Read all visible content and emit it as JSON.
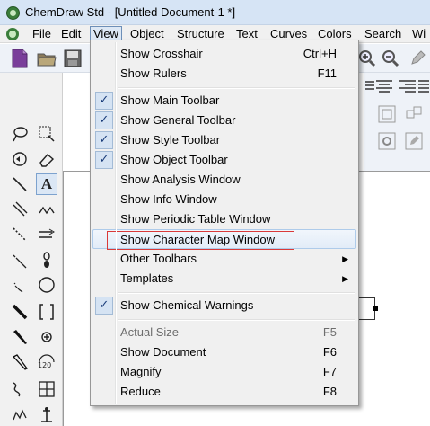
{
  "window": {
    "title": "ChemDraw Std - [Untitled Document-1 *]"
  },
  "menubar": {
    "items": [
      {
        "label": "File"
      },
      {
        "label": "Edit"
      },
      {
        "label": "View"
      },
      {
        "label": "Object"
      },
      {
        "label": "Structure"
      },
      {
        "label": "Text"
      },
      {
        "label": "Curves"
      },
      {
        "label": "Colors"
      },
      {
        "label": "Search"
      },
      {
        "label": "Wi"
      }
    ],
    "active": "View"
  },
  "view_menu": {
    "items": [
      {
        "label": "Show Crosshair",
        "shortcut": "Ctrl+H",
        "checked": false
      },
      {
        "label": "Show Rulers",
        "shortcut": "F11",
        "checked": false
      },
      {
        "label": "Show Main Toolbar",
        "checked": true
      },
      {
        "label": "Show General Toolbar",
        "checked": true
      },
      {
        "label": "Show Style Toolbar",
        "checked": true
      },
      {
        "label": "Show Object Toolbar",
        "checked": true
      },
      {
        "label": "Show Analysis Window",
        "checked": false
      },
      {
        "label": "Show Info Window",
        "checked": false
      },
      {
        "label": "Show Periodic Table Window",
        "checked": false
      },
      {
        "label": "Show Character Map Window",
        "checked": false,
        "highlighted": true
      },
      {
        "label": "Other Toolbars",
        "submenu": true
      },
      {
        "label": "Templates",
        "submenu": true
      },
      {
        "label": "Show Chemical Warnings",
        "checked": true
      },
      {
        "label": "Actual Size",
        "shortcut": "F5",
        "disabled": true
      },
      {
        "label": "Show Document",
        "shortcut": "F6"
      },
      {
        "label": "Magnify",
        "shortcut": "F7"
      },
      {
        "label": "Reduce",
        "shortcut": "F8"
      }
    ],
    "check_glyph": "✓",
    "submenu_glyph": "▶"
  },
  "palette_text": {
    "text_tool": "A",
    "number_label": "120"
  },
  "colors": {
    "highlight_border": "#d93a3a",
    "check_bg": "#d5e3f3",
    "titlebar": "#d6e4f5",
    "disabled_text": "#6d6d6d"
  }
}
